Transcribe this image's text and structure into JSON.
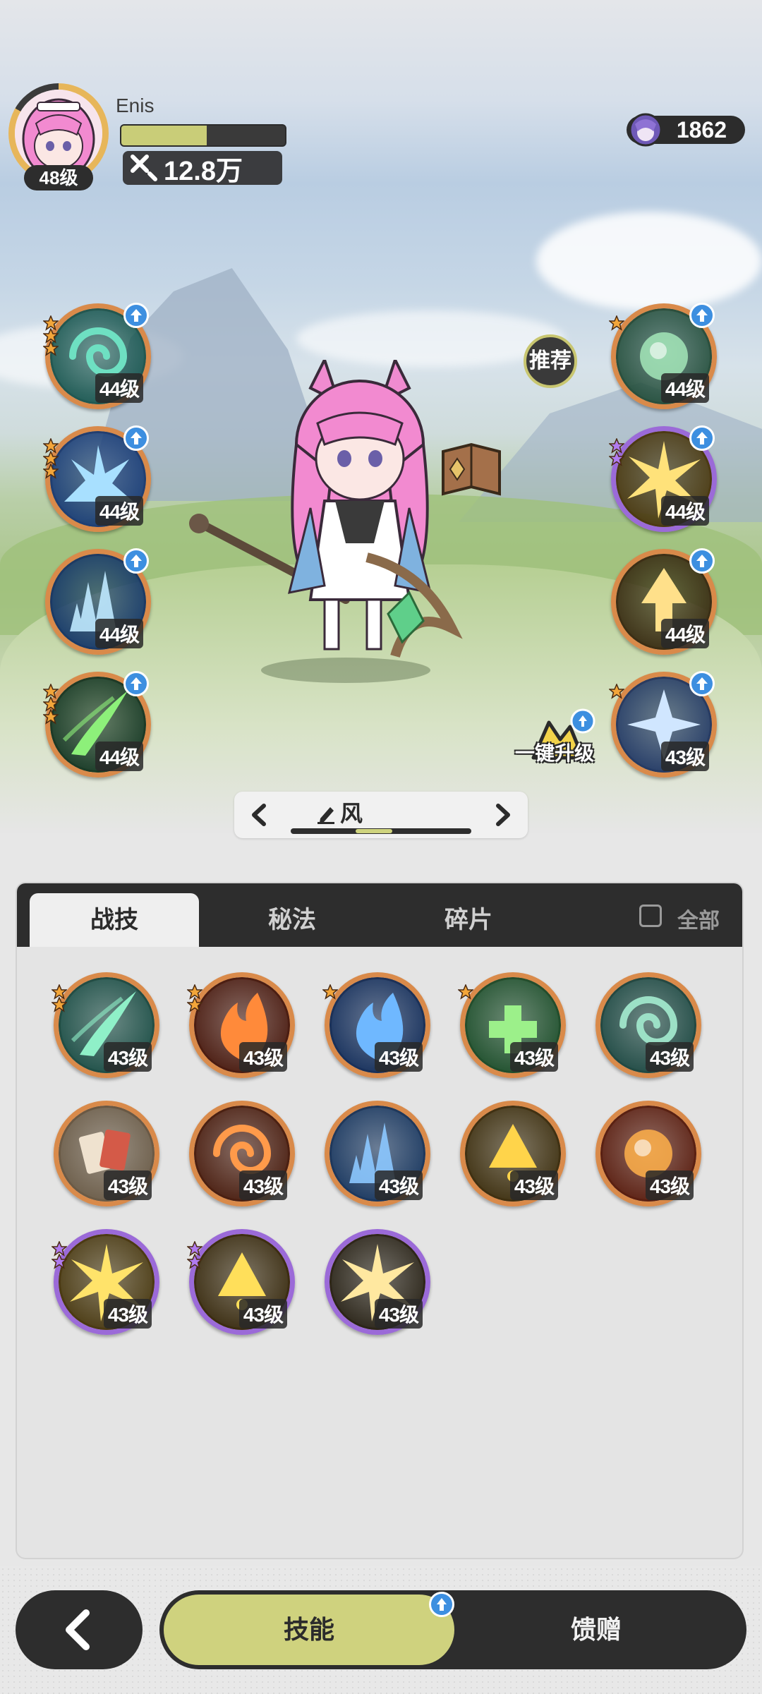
{
  "player": {
    "name": "Enis",
    "level_label": "48级",
    "xp_fraction": 0.52,
    "power": "12.8万"
  },
  "currency": {
    "value": "1862"
  },
  "scene": {
    "recommend_label": "推荐",
    "one_key_upgrade_label": "一键升级"
  },
  "element_selector": {
    "current": "风",
    "scroll_fraction": 0.45
  },
  "left_skills": [
    {
      "level": "44级",
      "stars": 3,
      "frame": "orange",
      "art": "wind-spiral"
    },
    {
      "level": "44级",
      "stars": 3,
      "frame": "orange",
      "art": "ice-burst"
    },
    {
      "level": "44级",
      "stars": 0,
      "frame": "orange",
      "art": "ice-crystal"
    },
    {
      "level": "44级",
      "stars": 3,
      "frame": "orange",
      "art": "green-slash"
    }
  ],
  "right_skills": [
    {
      "level": "44级",
      "stars": 1,
      "frame": "orange",
      "art": "green-orb"
    },
    {
      "level": "44级",
      "stars": 2,
      "frame": "purple",
      "art": "gold-burst"
    },
    {
      "level": "44级",
      "stars": 0,
      "frame": "orange",
      "art": "gold-arrow"
    },
    {
      "level": "43级",
      "stars": 1,
      "frame": "orange",
      "art": "blue-star"
    }
  ],
  "panel": {
    "tabs": [
      "战技",
      "秘法",
      "碎片"
    ],
    "active_tab": 0,
    "all_label": "全部",
    "skills": [
      {
        "level": "43级",
        "stars": 2,
        "frame": "orange",
        "art": "green-claw"
      },
      {
        "level": "43级",
        "stars": 2,
        "frame": "orange",
        "art": "fire-blast"
      },
      {
        "level": "43级",
        "stars": 1,
        "frame": "orange",
        "art": "blue-flame"
      },
      {
        "level": "43级",
        "stars": 1,
        "frame": "orange",
        "art": "green-heal"
      },
      {
        "level": "43级",
        "stars": 0,
        "frame": "orange",
        "art": "thorn"
      },
      {
        "level": "43级",
        "stars": 0,
        "frame": "orange",
        "art": "cards"
      },
      {
        "level": "43级",
        "stars": 0,
        "frame": "orange",
        "art": "fire-swirl"
      },
      {
        "level": "43级",
        "stars": 0,
        "frame": "orange",
        "art": "ice-shard"
      },
      {
        "level": "43级",
        "stars": 0,
        "frame": "orange",
        "art": "gold-triangle"
      },
      {
        "level": "43级",
        "stars": 0,
        "frame": "orange",
        "art": "fire-orb"
      },
      {
        "level": "43级",
        "stars": 2,
        "frame": "purple",
        "art": "gold-spark"
      },
      {
        "level": "43级",
        "stars": 2,
        "frame": "purple",
        "art": "gold-sun"
      },
      {
        "level": "43级",
        "stars": 0,
        "frame": "purple",
        "art": "lightning"
      }
    ]
  },
  "bottom_nav": {
    "skills_label": "技能",
    "gift_label": "馈赠"
  },
  "colors": {
    "accent": "#cfd27e",
    "dark": "#2d2d2d",
    "orange_frame": "#d98a4a",
    "purple_frame": "#9b6ad8",
    "upgrade_blue": "#3d8fe0"
  }
}
